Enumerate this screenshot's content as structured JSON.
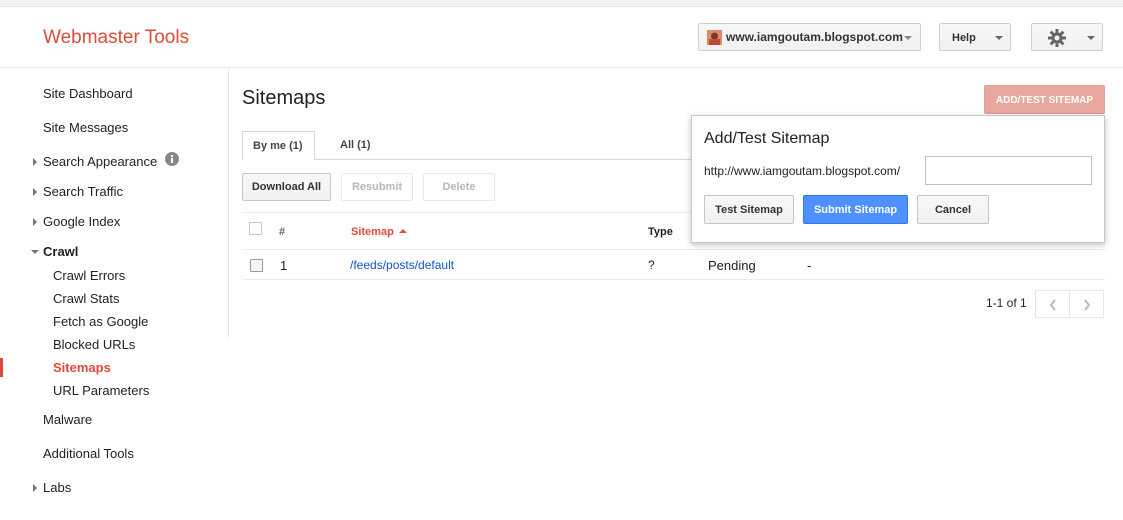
{
  "header": {
    "app_title": "Webmaster Tools",
    "site": "www.iamgoutam.blogspot.com",
    "help_label": "Help",
    "accent": "#dd4b39"
  },
  "sidebar": {
    "items": [
      {
        "label": "Site Dashboard"
      },
      {
        "label": "Site Messages"
      },
      {
        "label": "Search Appearance"
      },
      {
        "label": "Search Traffic"
      },
      {
        "label": "Google Index"
      },
      {
        "label": "Crawl"
      },
      {
        "label": "Crawl Errors"
      },
      {
        "label": "Crawl Stats"
      },
      {
        "label": "Fetch as Google"
      },
      {
        "label": "Blocked URLs"
      },
      {
        "label": "Sitemaps"
      },
      {
        "label": "URL Parameters"
      },
      {
        "label": "Malware"
      },
      {
        "label": "Additional Tools"
      },
      {
        "label": "Labs"
      }
    ],
    "active": "Sitemaps"
  },
  "main": {
    "title": "Sitemaps",
    "add_test_label": "ADD/TEST SITEMAP",
    "tabs": [
      {
        "label": "By me (1)"
      },
      {
        "label": "All (1)"
      }
    ],
    "actions": {
      "download_all": "Download All",
      "resubmit": "Resubmit",
      "delete": "Delete"
    },
    "table": {
      "headers": {
        "num": "#",
        "sitemap": "Sitemap",
        "type": "Type"
      },
      "rows": [
        {
          "num": "1",
          "sitemap": "/feeds/posts/default",
          "type": "?",
          "status": "Pending",
          "extra": "-"
        }
      ]
    },
    "pagination": "1-1 of 1"
  },
  "popup": {
    "title": "Add/Test Sitemap",
    "prefix": "http://www.iamgoutam.blogspot.com/",
    "input_value": "",
    "test_label": "Test Sitemap",
    "submit_label": "Submit Sitemap",
    "cancel_label": "Cancel",
    "submit_color": "#4d90fe"
  }
}
